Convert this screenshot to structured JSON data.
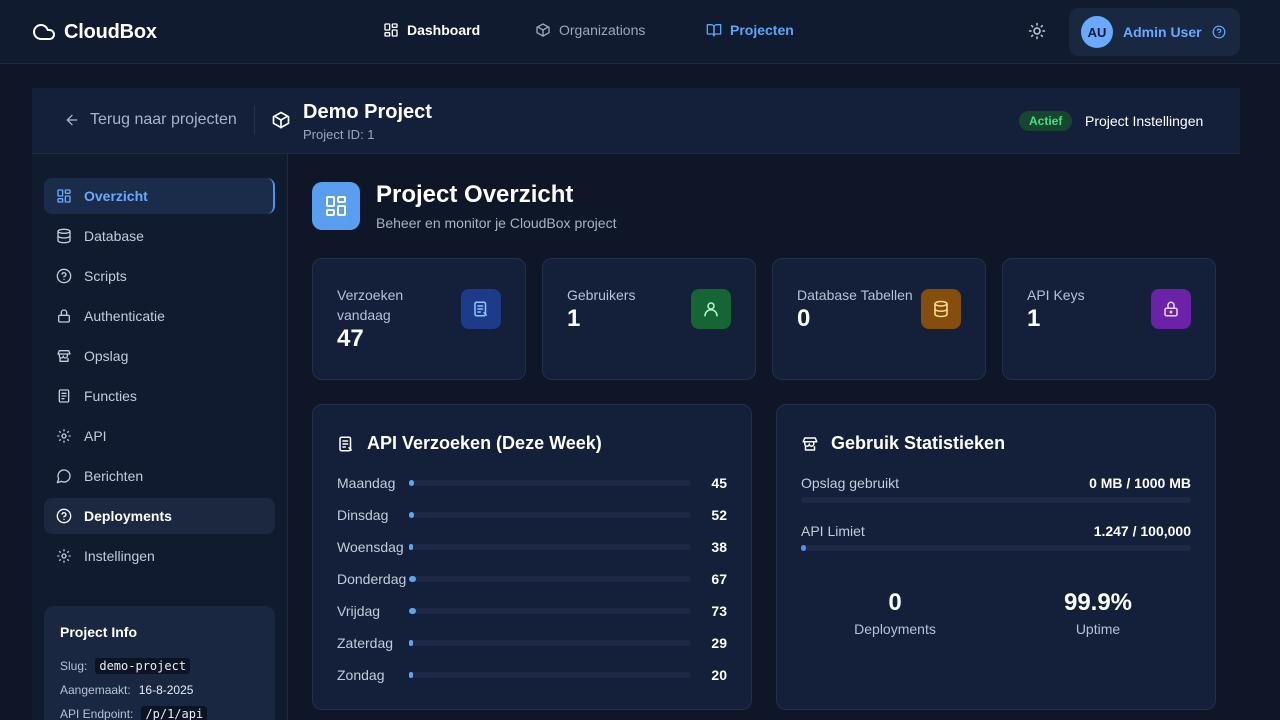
{
  "brand": {
    "name": "CloudBox",
    "icon": "cloud-icon"
  },
  "nav": [
    {
      "label": "Dashboard",
      "icon": "grid-icon",
      "active": false
    },
    {
      "label": "Organizations",
      "icon": "cube-icon",
      "active": false
    },
    {
      "label": "Projecten",
      "icon": "book-icon",
      "active": true
    }
  ],
  "user": {
    "initials": "AU",
    "name": "Admin User"
  },
  "project": {
    "back_label": "Terug naar projecten",
    "title": "Demo Project",
    "id_label": "Project ID: 1",
    "status": "Actief",
    "settings_label": "Project Instellingen"
  },
  "sidebar": {
    "items": [
      {
        "label": "Overzicht",
        "icon": "grid-icon"
      },
      {
        "label": "Database",
        "icon": "database-icon"
      },
      {
        "label": "Scripts",
        "icon": "help-circle-icon"
      },
      {
        "label": "Authenticatie",
        "icon": "lock-icon"
      },
      {
        "label": "Opslag",
        "icon": "storage-icon"
      },
      {
        "label": "Functies",
        "icon": "function-icon"
      },
      {
        "label": "API",
        "icon": "gear-icon"
      },
      {
        "label": "Berichten",
        "icon": "message-icon"
      },
      {
        "label": "Deployments",
        "icon": "help-circle-icon"
      },
      {
        "label": "Instellingen",
        "icon": "gear-icon"
      }
    ],
    "info": {
      "title": "Project Info",
      "slug_label": "Slug:",
      "slug": "demo-project",
      "created_label": "Aangemaakt:",
      "created": "16-8-2025",
      "endpoint_label": "API Endpoint:",
      "endpoint": "/p/1/api"
    }
  },
  "overview": {
    "title": "Project Overzicht",
    "subtitle": "Beheer en monitor je CloudBox project"
  },
  "stats": [
    {
      "label": "Verzoeken vandaag",
      "value": "47",
      "icon": "request-icon",
      "color": "#1e3a8a"
    },
    {
      "label": "Gebruikers",
      "value": "1",
      "icon": "user-icon",
      "color": "#166534"
    },
    {
      "label": "Database Tabellen",
      "value": "0",
      "icon": "database-icon",
      "color": "#854d0e"
    },
    {
      "label": "API Keys",
      "value": "1",
      "icon": "lock-icon",
      "color": "#6b21a8"
    }
  ],
  "api_panel": {
    "title": "API Verzoeken (Deze Week)",
    "rows": [
      {
        "day": "Maandag",
        "value": 45
      },
      {
        "day": "Dinsdag",
        "value": 52
      },
      {
        "day": "Woensdag",
        "value": 38
      },
      {
        "day": "Donderdag",
        "value": 67
      },
      {
        "day": "Vrijdag",
        "value": 73
      },
      {
        "day": "Zaterdag",
        "value": 29
      },
      {
        "day": "Zondag",
        "value": 20
      }
    ]
  },
  "usage_panel": {
    "title": "Gebruik Statistieken",
    "storage_label": "Opslag gebruikt",
    "storage_value": "0 MB / 1000 MB",
    "storage_fraction": 0,
    "api_label": "API Limiet",
    "api_value": "1.247 / 100,000",
    "api_fraction": 0.01247,
    "deployments_value": "0",
    "deployments_label": "Deployments",
    "uptime_value": "99.9%",
    "uptime_label": "Uptime"
  },
  "colors": {
    "accent": "#5ea4f5",
    "background": "#0e1628",
    "panel": "#14203a",
    "success": "#4ade80"
  }
}
